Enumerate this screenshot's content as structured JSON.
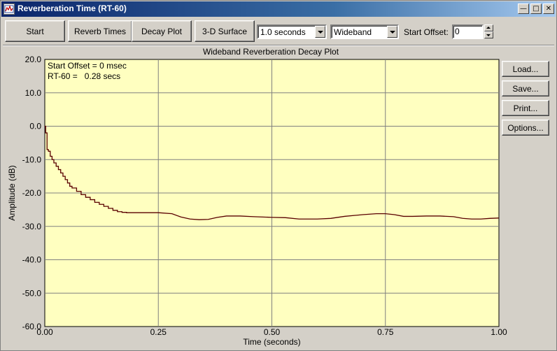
{
  "window": {
    "title": "Reverberation Time (RT-60)",
    "icon": "analyzer-app-icon",
    "controls": [
      "minimize-icon",
      "maximize-icon",
      "close-icon"
    ]
  },
  "toolbar": {
    "start_label": "Start",
    "reverb_times_label": "Reverb Times",
    "decay_plot_label": "Decay Plot",
    "surface_label": "3-D Surface",
    "duration_value": "1.0 seconds",
    "band_value": "Wideband",
    "offset_label": "Start Offset:",
    "offset_value": "0"
  },
  "side_buttons": {
    "load": "Load...",
    "save": "Save...",
    "print": "Print...",
    "options": "Options..."
  },
  "chart_data": {
    "type": "line",
    "title": "Wideband Reverberation Decay Plot",
    "xlabel": "Time (seconds)",
    "ylabel": "Amplitude (dB)",
    "xlim": [
      0.0,
      1.0
    ],
    "ylim": [
      -60.0,
      20.0
    ],
    "x_ticks": [
      "0.00",
      "0.25",
      "0.50",
      "0.75",
      "1.00"
    ],
    "x_tick_values": [
      0.0,
      0.25,
      0.5,
      0.75,
      1.0
    ],
    "y_ticks": [
      "20.0",
      "10.0",
      "0.0",
      "-10.0",
      "-20.0",
      "-30.0",
      "-40.0",
      "-50.0",
      "-60.0"
    ],
    "y_tick_values": [
      20,
      10,
      0,
      -10,
      -20,
      -30,
      -40,
      -50,
      -60
    ],
    "grid": true,
    "background": "#ffffc0",
    "line_color": "#5a0000",
    "annotations": [
      "Start Offset = 0 msec",
      "RT-60 =   0.28 secs"
    ],
    "series": [
      {
        "x": [
          0.0,
          0.002,
          0.005,
          0.008,
          0.012,
          0.016,
          0.02,
          0.025,
          0.03,
          0.035,
          0.04,
          0.045,
          0.05,
          0.055,
          0.06,
          0.07,
          0.08,
          0.09,
          0.1,
          0.11,
          0.12,
          0.13,
          0.14,
          0.15,
          0.16,
          0.17,
          0.18,
          0.2,
          0.22,
          0.25,
          0.28,
          0.3,
          0.32,
          0.34,
          0.36,
          0.38,
          0.4,
          0.43,
          0.46,
          0.5,
          0.53,
          0.56,
          0.6,
          0.63,
          0.66,
          0.7,
          0.73,
          0.75,
          0.77,
          0.79,
          0.81,
          0.84,
          0.87,
          0.9,
          0.92,
          0.94,
          0.96,
          0.98,
          1.0
        ],
        "y": [
          0.0,
          -2.0,
          -7.0,
          -7.5,
          -9.0,
          -10.0,
          -11.0,
          -12.0,
          -13.0,
          -14.0,
          -15.0,
          -16.0,
          -17.0,
          -18.0,
          -18.5,
          -19.5,
          -20.5,
          -21.3,
          -22.0,
          -22.8,
          -23.4,
          -24.0,
          -24.6,
          -25.2,
          -25.6,
          -25.8,
          -25.9,
          -25.9,
          -25.9,
          -25.9,
          -26.2,
          -27.2,
          -27.8,
          -28.0,
          -27.9,
          -27.3,
          -26.9,
          -26.9,
          -27.1,
          -27.3,
          -27.4,
          -27.8,
          -27.8,
          -27.6,
          -27.0,
          -26.5,
          -26.2,
          -26.2,
          -26.5,
          -27.0,
          -27.0,
          -26.9,
          -26.9,
          -27.1,
          -27.6,
          -27.8,
          -27.8,
          -27.6,
          -27.5
        ]
      }
    ]
  }
}
